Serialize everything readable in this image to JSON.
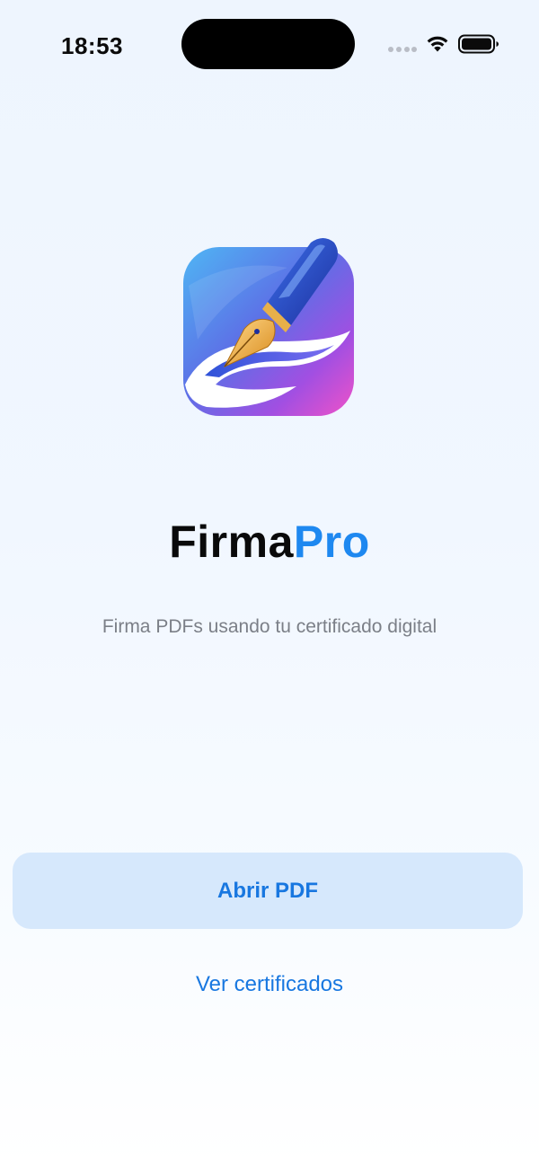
{
  "status_bar": {
    "time": "18:53",
    "icons": [
      "cellular-signal-icon",
      "wifi-icon",
      "battery-icon"
    ]
  },
  "app": {
    "icon": "fountain-pen-app-icon",
    "title_main": "Firma",
    "title_accent": "Pro",
    "subtitle": "Firma PDFs usando tu certificado digital"
  },
  "actions": {
    "open_pdf_label": "Abrir PDF",
    "view_certificates_label": "Ver certificados"
  },
  "colors": {
    "accent": "#1e88f0",
    "button_bg": "#d6e8fc",
    "button_text": "#1877e0",
    "subtitle": "#7b7f87"
  }
}
